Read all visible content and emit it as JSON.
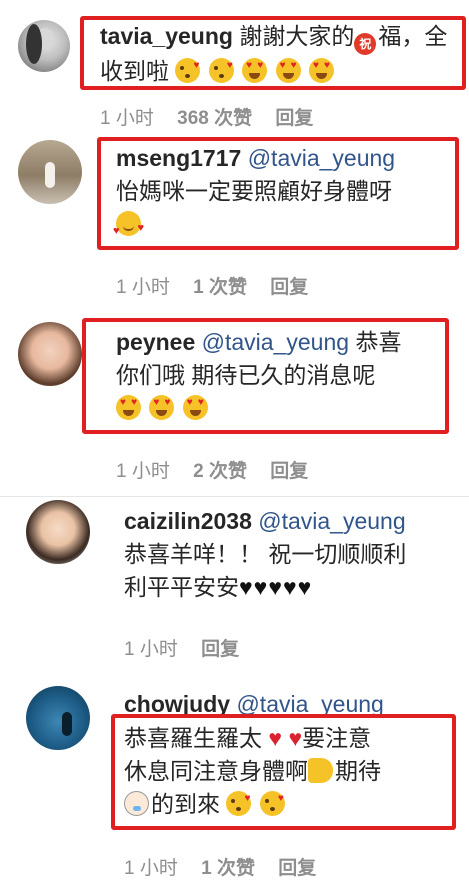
{
  "comments": [
    {
      "username": "tavia_yeung",
      "mention": "",
      "text_line1": "謝謝大家的",
      "blessing_glyph": "祝",
      "text_line1b": "福，全",
      "text_line2": "收到啦",
      "time": "1 小时",
      "likes": "368 次赞",
      "reply": "回复"
    },
    {
      "username": "mseng1717",
      "mention": "@tavia_yeung",
      "text_line1": "怡媽咪一定要照顧好身體呀",
      "time": "1 小时",
      "likes": "1 次赞",
      "reply": "回复"
    },
    {
      "username": "peynee",
      "mention": "@tavia_yeung",
      "text_line1": "恭喜",
      "text_line2": "你们哦 期待已久的消息呢",
      "time": "1 小时",
      "likes": "2 次赞",
      "reply": "回复"
    },
    {
      "username": "caizilin2038",
      "mention": "@tavia_yeung",
      "text_line1": "恭喜羊咩！！ 祝一切顺顺利",
      "text_line2": "利平平安安",
      "black_hearts": "♥♥♥♥♥",
      "time": "1 小时",
      "reply": "回复"
    },
    {
      "username": "chowjudy",
      "mention": "@tavia_yeung",
      "text_line1": "恭喜羅生羅太",
      "text_line1b": "要注意",
      "text_line2": "休息同注意身體啊",
      "text_line2b": "期待",
      "text_line3": "的到來",
      "time": "1 小时",
      "likes": "1 次赞",
      "reply": "回复"
    }
  ],
  "colors": {
    "highlight_box": "#e02020",
    "mention": "#31558b",
    "meta_text": "#8e8e8e"
  }
}
